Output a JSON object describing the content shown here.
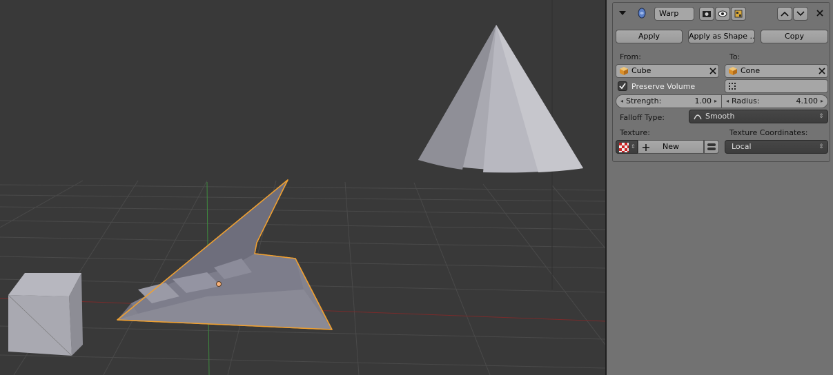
{
  "modifier": {
    "name": "Warp",
    "icons": {
      "collapse": "triangle-down-icon",
      "type": "warp-modifier-icon",
      "render": "camera-icon",
      "viewport": "eye-icon",
      "editmode": "editmode-icon",
      "move_up": "arrow-up-icon",
      "move_down": "arrow-down-icon",
      "close": "close-icon"
    }
  },
  "actions": {
    "apply": "Apply",
    "apply_as_shape": "Apply as Shape ...",
    "copy": "Copy"
  },
  "from": {
    "label": "From:",
    "value": "Cube"
  },
  "to": {
    "label": "To:",
    "value": "Cone"
  },
  "preserve_volume": {
    "label": "Preserve Volume",
    "checked": true
  },
  "strength": {
    "label": "Strength:",
    "value": "1.00"
  },
  "radius": {
    "label": "Radius:",
    "value": "4.100"
  },
  "falloff": {
    "label": "Falloff Type:",
    "value": "Smooth"
  },
  "texture": {
    "label": "Texture:",
    "new_label": "New"
  },
  "texture_coordinates": {
    "label": "Texture Coordinates:",
    "value": "Local"
  },
  "colors": {
    "viewport_bg": "#393939",
    "panel_bg": "#727272",
    "selection_outline": "#f0a030",
    "mesh_gray": "#9a9aa6"
  }
}
